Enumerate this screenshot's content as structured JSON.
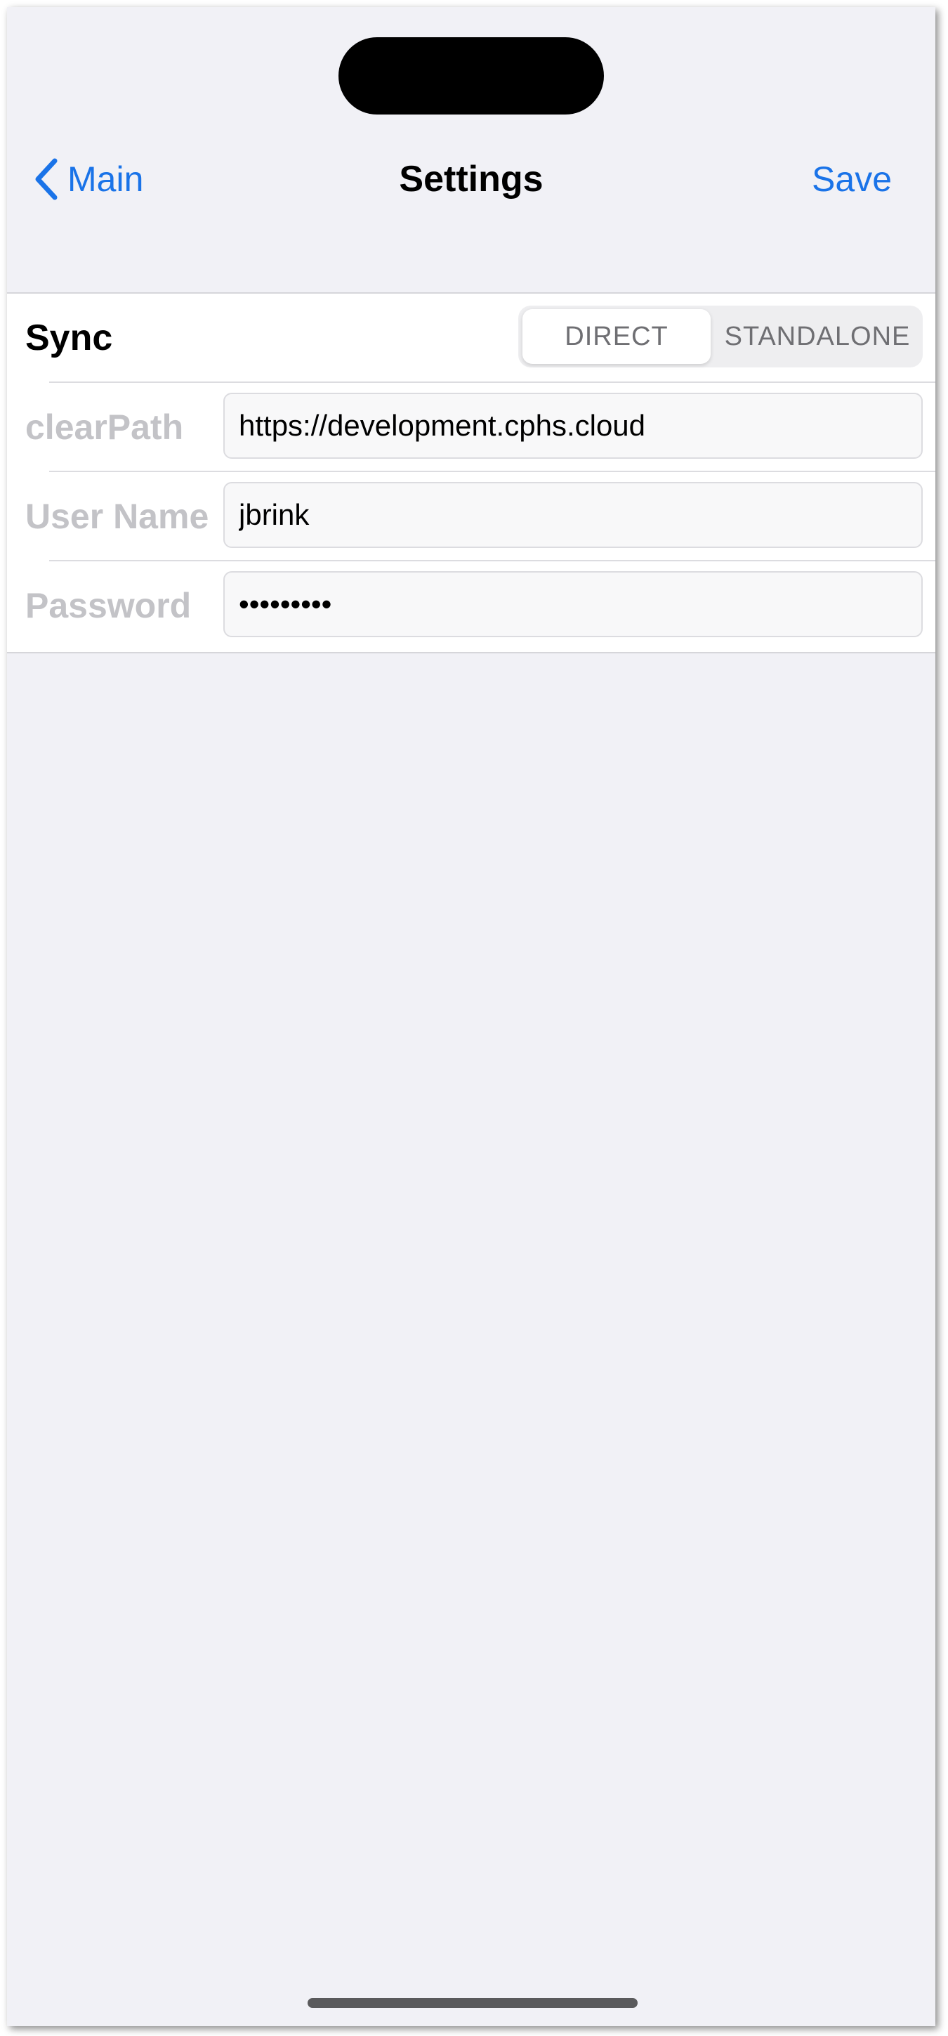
{
  "nav": {
    "back_label": "Main",
    "title": "Settings",
    "save_label": "Save"
  },
  "sync": {
    "label": "Sync",
    "options": [
      "DIRECT",
      "STANDALONE"
    ],
    "selected": "DIRECT"
  },
  "fields": {
    "clearpath": {
      "label": "clearPath",
      "value": "https://development.cphs.cloud"
    },
    "username": {
      "label": "User Name",
      "value": "jbrink"
    },
    "password": {
      "label": "Password",
      "value": "•••••••••"
    }
  },
  "colors": {
    "accent": "#1a73e8",
    "background": "#f1f1f6",
    "label_muted": "#c3c3c7"
  },
  "icons": {
    "back": "chevron-left-icon"
  }
}
